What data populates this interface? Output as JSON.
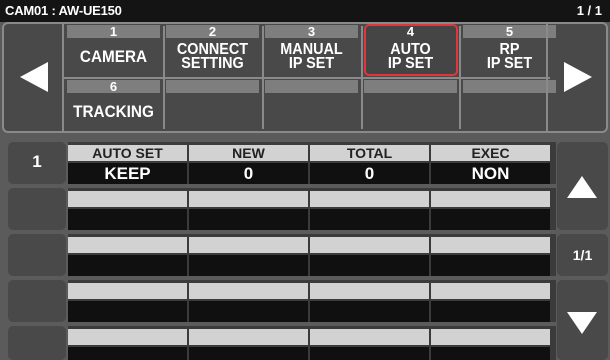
{
  "header": {
    "camera_label": "CAM01 : AW-UE150",
    "page_indicator": "1 / 1"
  },
  "nav": {
    "prev_icon": "left-triangle-icon",
    "next_icon": "right-triangle-icon"
  },
  "tabs": [
    {
      "number": "1",
      "label": "CAMERA"
    },
    {
      "number": "2",
      "label": "CONNECT\nSETTING"
    },
    {
      "number": "3",
      "label": "MANUAL\nIP SET"
    },
    {
      "number": "4",
      "label": "AUTO\nIP SET",
      "selected": true
    },
    {
      "number": "5",
      "label": "RP\nIP SET"
    },
    {
      "number": "6",
      "label": "TRACKING"
    }
  ],
  "table": {
    "columns": [
      "AUTO SET",
      "NEW",
      "TOTAL",
      "EXEC"
    ],
    "rows": [
      {
        "number": "1",
        "values": [
          "KEEP",
          "0",
          "0",
          "NON"
        ]
      },
      {
        "number": "",
        "values": [
          "",
          "",
          "",
          ""
        ]
      },
      {
        "number": "",
        "values": [
          "",
          "",
          "",
          ""
        ]
      },
      {
        "number": "",
        "values": [
          "",
          "",
          "",
          ""
        ]
      },
      {
        "number": "",
        "values": [
          "",
          "",
          "",
          ""
        ]
      }
    ]
  },
  "scroll": {
    "up_icon": "up-triangle-icon",
    "page": "1/1",
    "down_icon": "down-triangle-icon"
  },
  "colors": {
    "selected_outline": "#e0363c",
    "background": "#5b5b5b",
    "header_cell": "#d2d2d2",
    "value_cell": "#101010"
  }
}
